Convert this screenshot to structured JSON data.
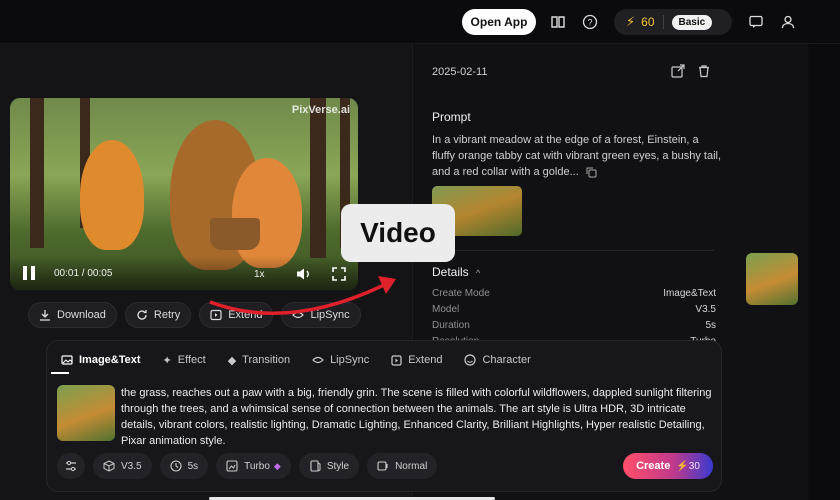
{
  "topbar": {
    "open_app_label": "Open App",
    "credits": "60",
    "plan_badge": "Basic",
    "icons": [
      "book-icon",
      "help-icon",
      "lightning-icon",
      "chat-icon",
      "user-icon"
    ]
  },
  "video": {
    "watermark": "PixVerse.ai",
    "timecode": "00:01 / 00:05",
    "speed": "1x"
  },
  "actions": {
    "download": "Download",
    "retry": "Retry",
    "extend": "Extend",
    "lipsync": "LipSync"
  },
  "detail": {
    "date": "2025-02-11",
    "prompt_title": "Prompt",
    "prompt_text": "In a vibrant meadow at the edge of a forest, Einstein, a fluffy orange tabby cat with vibrant green eyes, a bushy tail, and a red collar with a golde...",
    "details_title": "Details",
    "rows": [
      {
        "label": "Create Mode",
        "value": "Image&Text"
      },
      {
        "label": "Model",
        "value": "V3.5"
      },
      {
        "label": "Duration",
        "value": "5s"
      },
      {
        "label": "Resolution",
        "value": "Turbo"
      }
    ]
  },
  "callout": {
    "label": "Video"
  },
  "composer": {
    "tabs": [
      {
        "label": "Image&Text"
      },
      {
        "label": "Effect"
      },
      {
        "label": "Transition"
      },
      {
        "label": "LipSync"
      },
      {
        "label": "Extend"
      },
      {
        "label": "Character"
      }
    ],
    "prompt": "the grass, reaches out a paw with a big, friendly grin. The scene is filled with colorful wildflowers, dappled sunlight filtering through the trees, and a whimsical sense of connection between the animals. The art style is Ultra HDR, 3D intricate details, vibrant colors, realistic lighting, Dramatic Lighting, Enhanced Clarity, Brilliant Highlights, Hyper realistic Detailing, Pixar animation style.",
    "options": {
      "model": "V3.5",
      "duration": "5s",
      "quality": "Turbo",
      "style": "Style",
      "motion": "Normal"
    },
    "create_label": "Create",
    "create_cost": "30"
  },
  "colors": {
    "background": "#0d0d0f",
    "panel": "#141417",
    "credits_accent": "#f4c430",
    "callout_arrow": "#e0202a"
  }
}
